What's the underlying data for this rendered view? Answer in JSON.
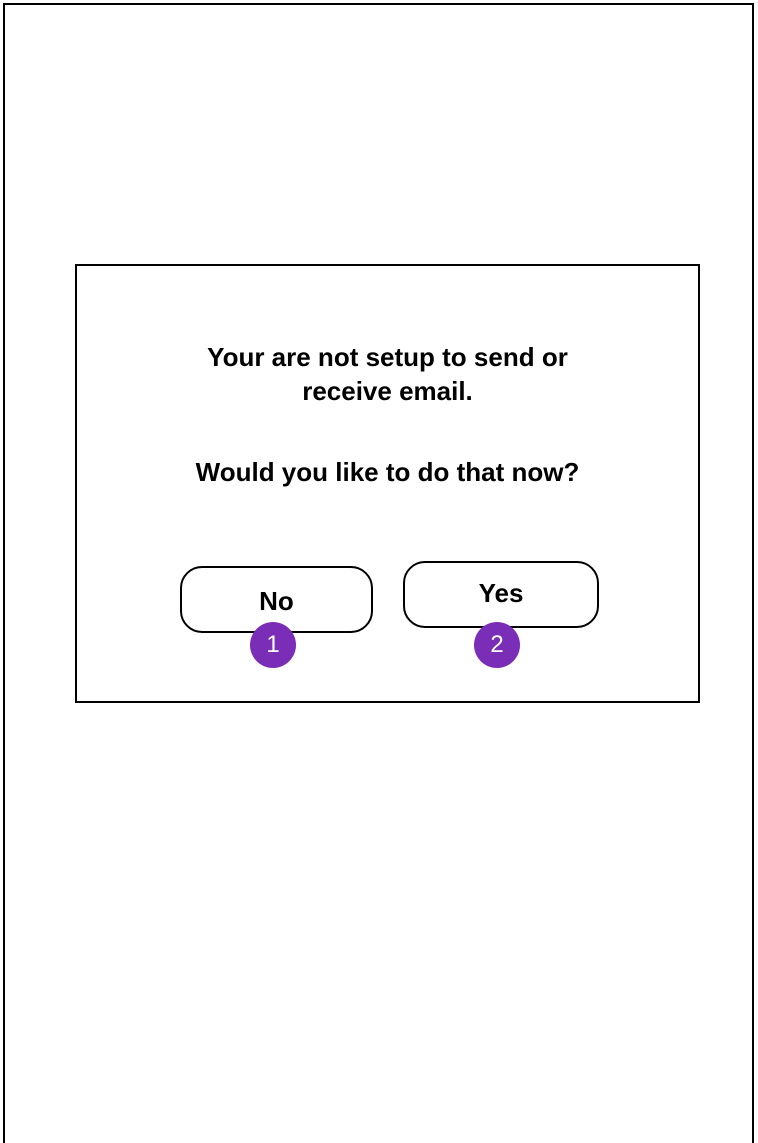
{
  "dialog": {
    "message_line1": "Your are not setup to send or",
    "message_line2": "receive email.",
    "question": "Would you like to do that now?",
    "no_label": "No",
    "yes_label": "Yes"
  },
  "annotations": {
    "no_marker": "1",
    "yes_marker": "2"
  },
  "colors": {
    "marker_fill": "#7a2db6",
    "marker_text": "#ffffff",
    "stroke": "#000000",
    "background": "#ffffff"
  }
}
